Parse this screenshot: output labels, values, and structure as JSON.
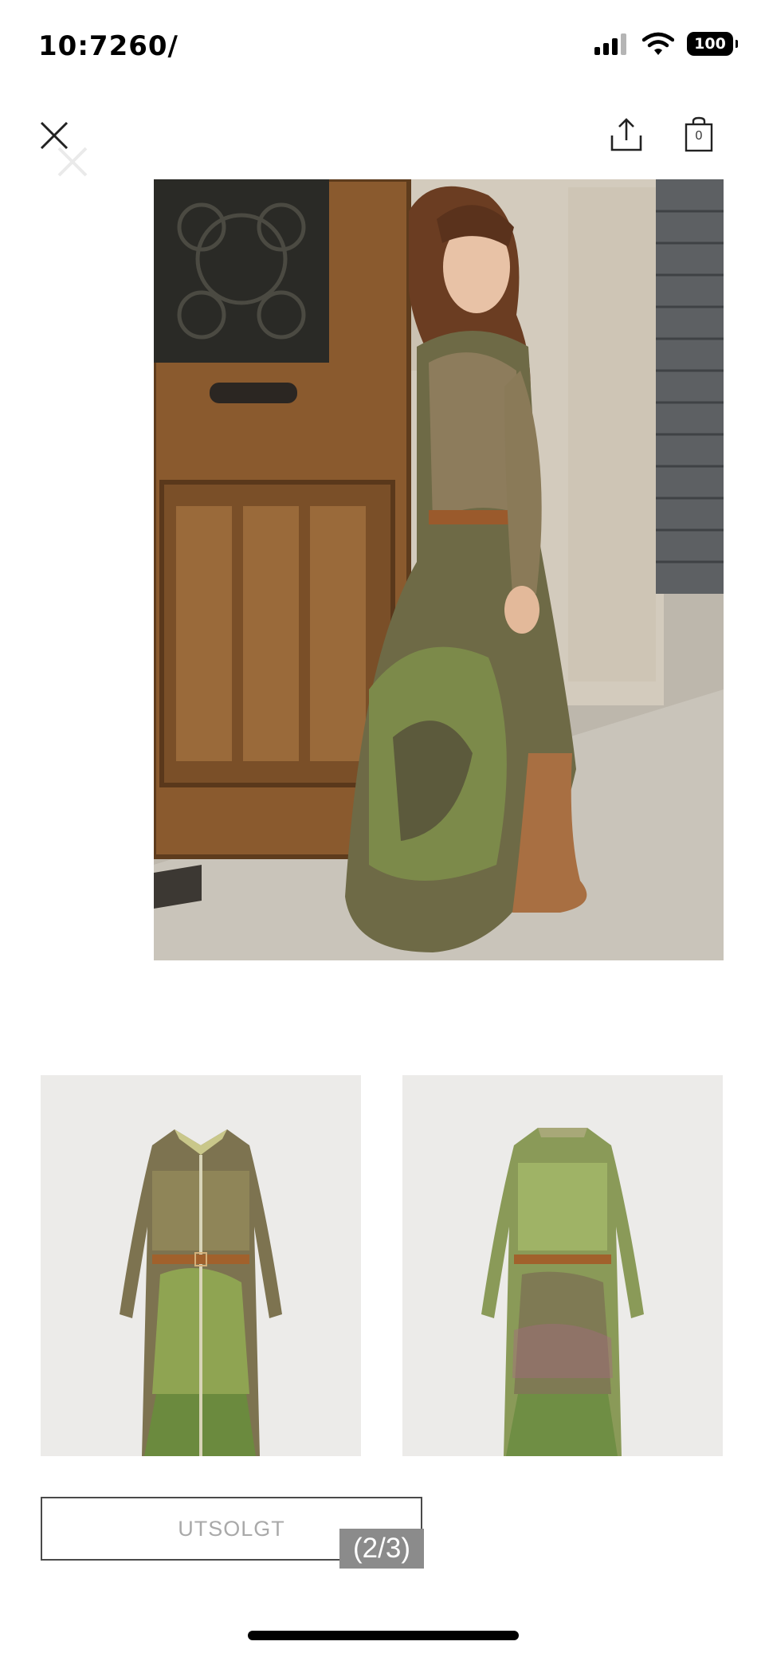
{
  "status_bar": {
    "time": "10:7260∕"
  },
  "status_icons": {
    "battery_level": "100",
    "signal": "signal-icon",
    "wifi": "wifi-icon"
  },
  "header": {
    "close_icon": "close-icon",
    "share_icon": "share-icon",
    "bag_icon": "shopping-bag-icon",
    "bag_count": "0"
  },
  "product": {
    "sold_out_label": "UTSOLGT",
    "page_indicator": "(2/3)"
  },
  "colors": {
    "background": "#ffffff",
    "thumbnail_background": "#ecebe9",
    "button_border": "#4a4a4a",
    "disabled_text": "#a9a9a9",
    "counter_background": "#8b8b8b"
  }
}
